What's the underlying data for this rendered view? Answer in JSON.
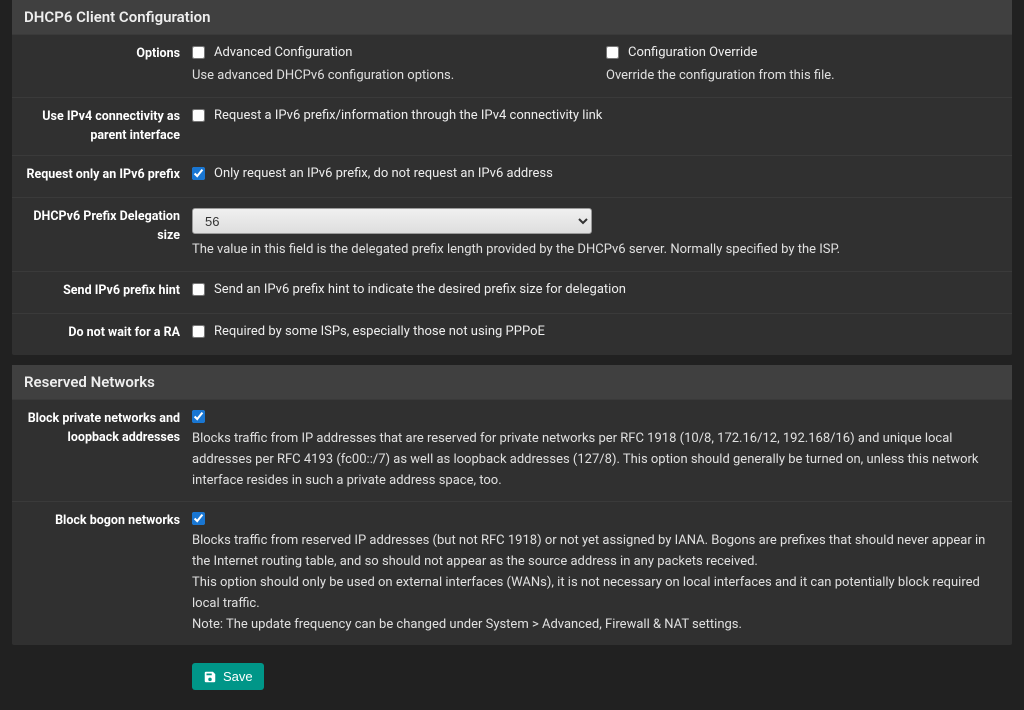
{
  "section1": {
    "title": "DHCP6 Client Configuration",
    "options": {
      "label": "Options",
      "adv": {
        "label": "Advanced Configuration",
        "help": "Use advanced DHCPv6 configuration options.",
        "checked": false
      },
      "override": {
        "label": "Configuration Override",
        "help": "Override the configuration from this file.",
        "checked": false
      }
    },
    "ipv4link": {
      "label": "Use IPv4 connectivity as parent interface",
      "check": {
        "label": "Request a IPv6 prefix/information through the IPv4 connectivity link",
        "checked": false
      }
    },
    "onlyprefix": {
      "label": "Request only an IPv6 prefix",
      "check": {
        "label": "Only request an IPv6 prefix, do not request an IPv6 address",
        "checked": true
      }
    },
    "delegsize": {
      "label": "DHCPv6 Prefix Delegation size",
      "value": "56",
      "help": "The value in this field is the delegated prefix length provided by the DHCPv6 server. Normally specified by the ISP."
    },
    "prefixhint": {
      "label": "Send IPv6 prefix hint",
      "check": {
        "label": "Send an IPv6 prefix hint to indicate the desired prefix size for delegation",
        "checked": false
      }
    },
    "nowaitra": {
      "label": "Do not wait for a RA",
      "check": {
        "label": "Required by some ISPs, especially those not using PPPoE",
        "checked": false
      }
    }
  },
  "section2": {
    "title": "Reserved Networks",
    "blockpriv": {
      "label": "Block private networks and loopback addresses",
      "checked": true,
      "help": "Blocks traffic from IP addresses that are reserved for private networks per RFC 1918 (10/8, 172.16/12, 192.168/16) and unique local addresses per RFC 4193 (fc00::/7) as well as loopback addresses (127/8). This option should generally be turned on, unless this network interface resides in such a private address space, too."
    },
    "blockbogon": {
      "label": "Block bogon networks",
      "checked": true,
      "help1": "Blocks traffic from reserved IP addresses (but not RFC 1918) or not yet assigned by IANA. Bogons are prefixes that should never appear in the Internet routing table, and so should not appear as the source address in any packets received.",
      "help2": "This option should only be used on external interfaces (WANs), it is not necessary on local interfaces and it can potentially block required local traffic.",
      "help3": "Note: The update frequency can be changed under System > Advanced, Firewall & NAT settings."
    }
  },
  "save_label": "Save"
}
